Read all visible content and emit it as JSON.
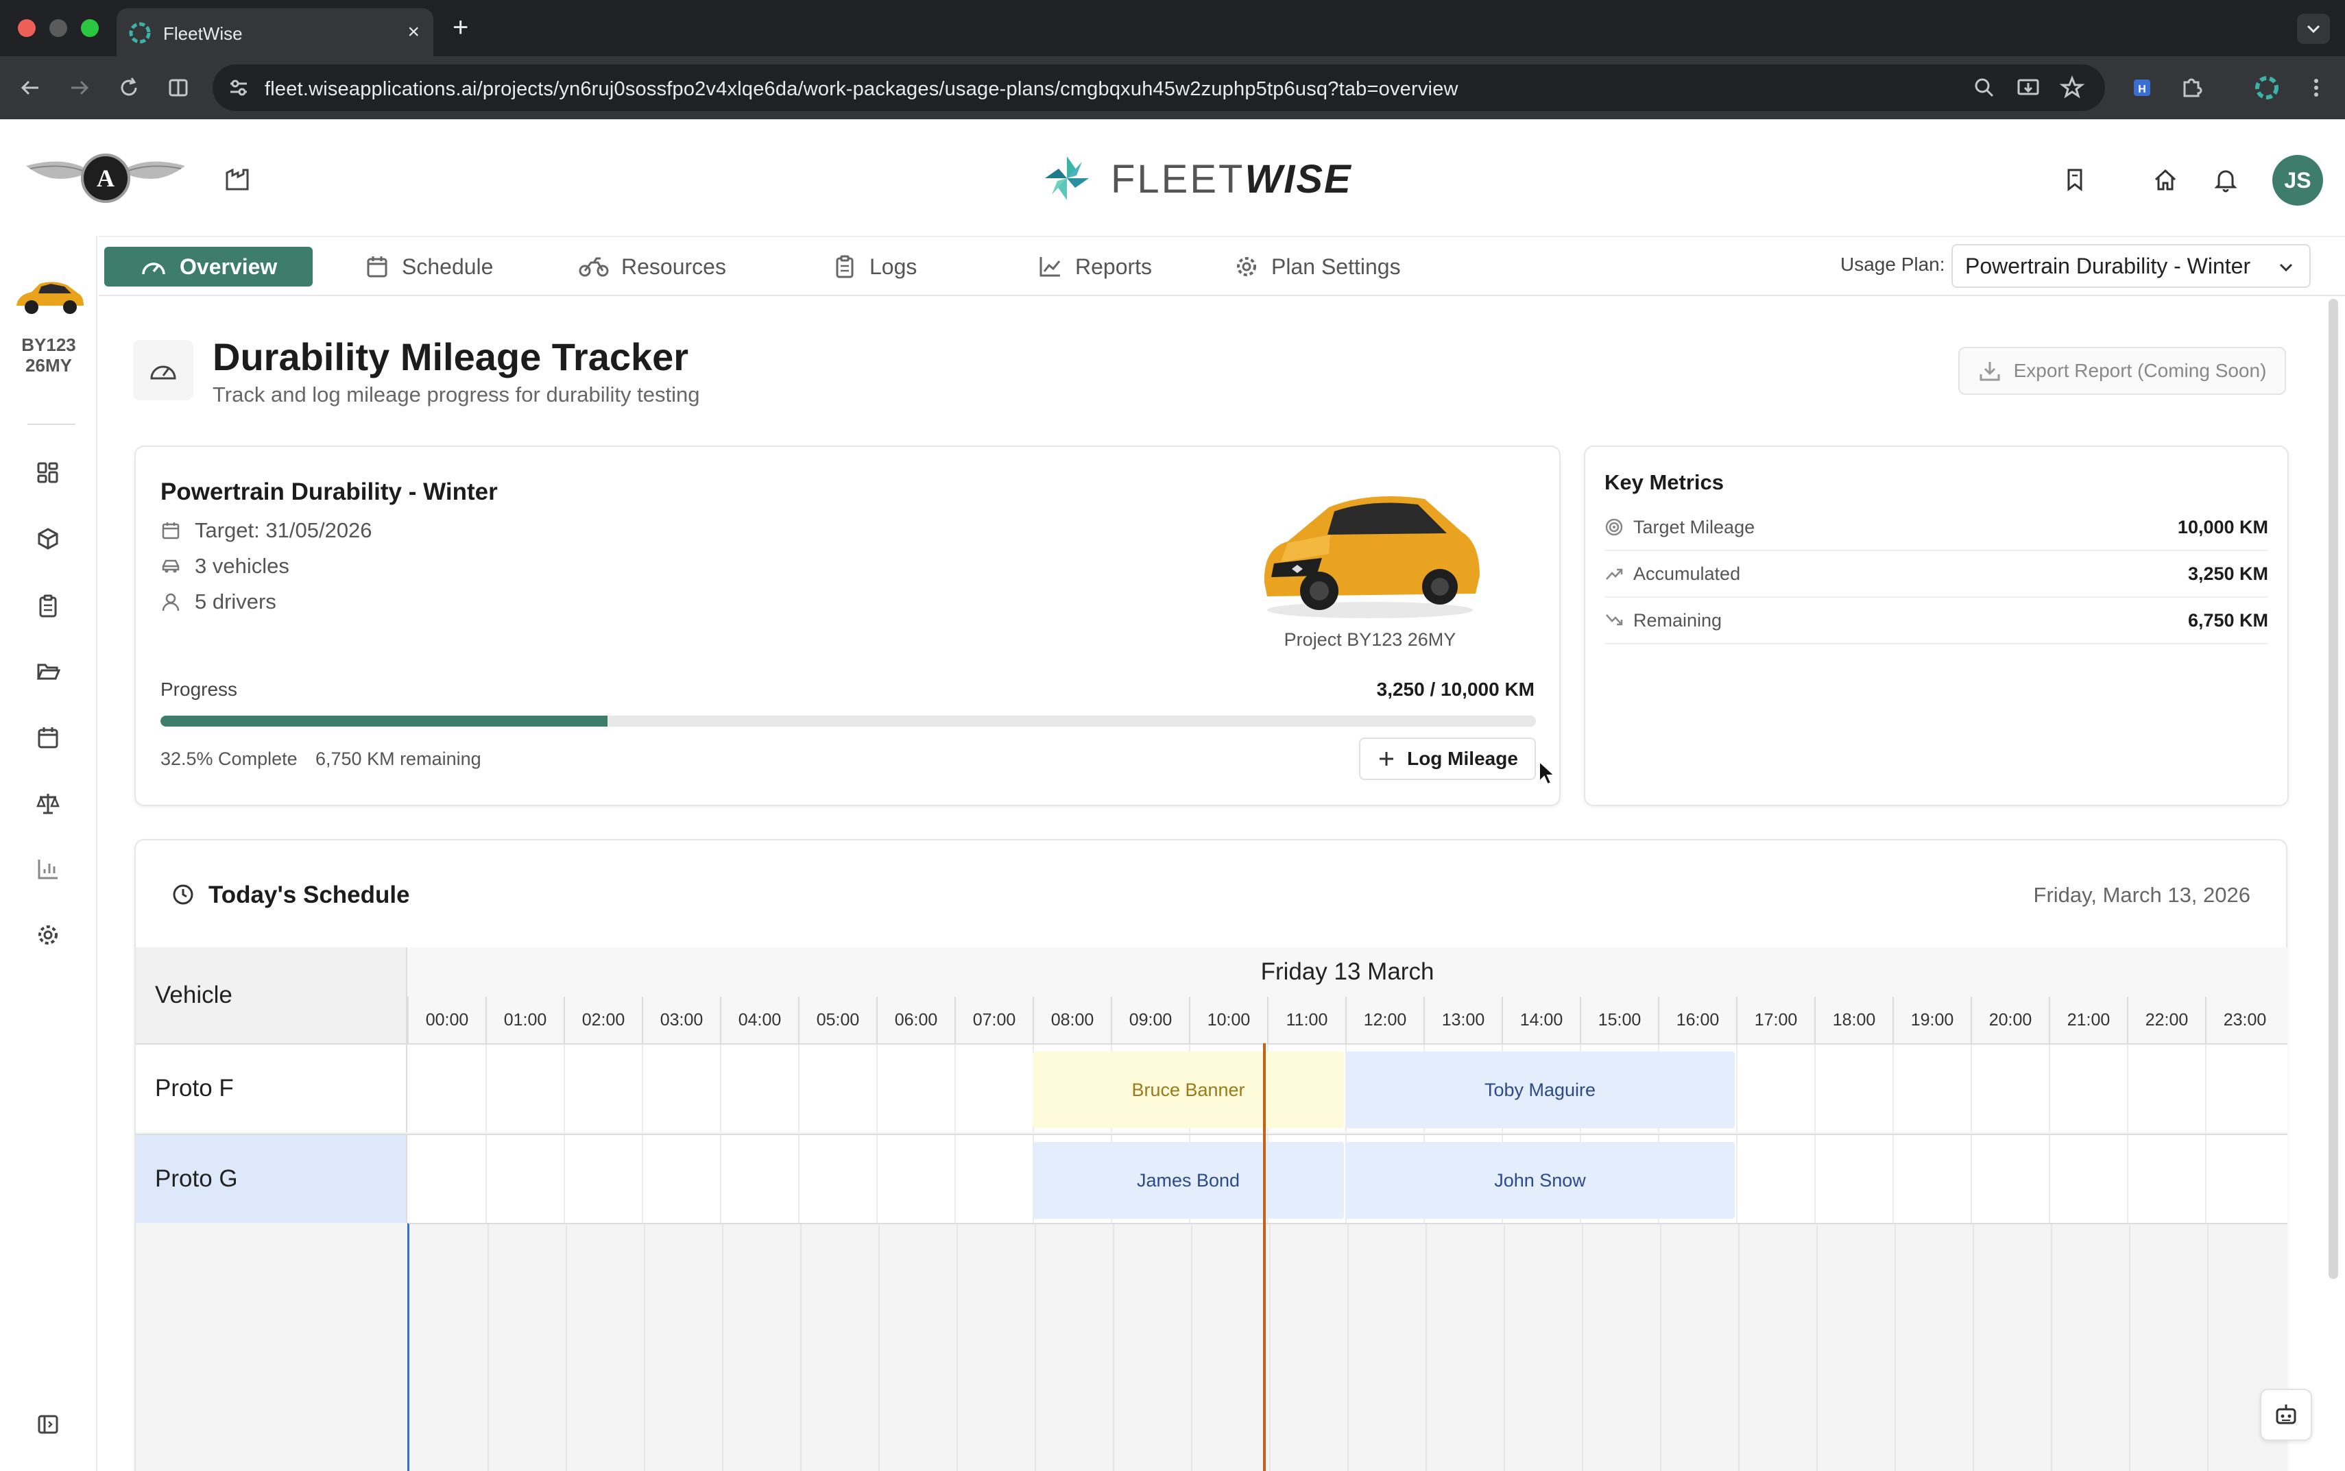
{
  "browser": {
    "tab_title": "FleetWise",
    "url": "fleet.wiseapplications.ai/projects/yn6ruj0sossfpo2v4xlqe6da/work-packages/usage-plans/cmgbqxuh45w2zuphp5tp6usq?tab=overview"
  },
  "brand": {
    "name_light": "FLEET",
    "name_bold": "WISE"
  },
  "user": {
    "initials": "JS"
  },
  "sidebar": {
    "vehicle_code_line1": "BY123",
    "vehicle_code_line2": "26MY",
    "icons": [
      "dashboard-icon",
      "cube-icon",
      "clipboard-icon",
      "folder-icon",
      "calendar-icon",
      "scales-icon",
      "bar-chart-icon",
      "gear-icon"
    ]
  },
  "nav": {
    "tabs": [
      {
        "label": "Overview",
        "icon": "gauge-icon",
        "active": true
      },
      {
        "label": "Schedule",
        "icon": "calendar-icon",
        "active": false
      },
      {
        "label": "Resources",
        "icon": "motorbike-icon",
        "active": false
      },
      {
        "label": "Logs",
        "icon": "clipboard-icon",
        "active": false
      },
      {
        "label": "Reports",
        "icon": "trend-chart-icon",
        "active": false
      },
      {
        "label": "Plan Settings",
        "icon": "gear-icon",
        "active": false
      }
    ],
    "usage_plan_label": "Usage Plan:",
    "usage_plan_value": "Powertrain Durability - Winter"
  },
  "page": {
    "title": "Durability Mileage Tracker",
    "subtitle": "Track and log mileage progress for durability testing",
    "export_label": "Export Report (Coming Soon)"
  },
  "plan": {
    "name": "Powertrain Durability - Winter",
    "target": "Target: 31/05/2026",
    "vehicles": "3 vehicles",
    "drivers": "5 drivers",
    "car_caption": "Project BY123 26MY",
    "progress_label": "Progress",
    "progress_value": "3,250 / 10,000 KM",
    "progress_fraction": 0.325,
    "complete_text": "32.5% Complete",
    "remaining_text": "6,750 KM remaining",
    "log_button": "Log Mileage"
  },
  "metrics": {
    "title": "Key Metrics",
    "rows": [
      {
        "label": "Target Mileage",
        "value": "10,000 KM",
        "icon": "target-icon"
      },
      {
        "label": "Accumulated",
        "value": "3,250 KM",
        "icon": "trend-up-icon"
      },
      {
        "label": "Remaining",
        "value": "6,750 KM",
        "icon": "trend-down-icon"
      }
    ]
  },
  "schedule": {
    "title": "Today's Schedule",
    "date": "Friday, March 13, 2026",
    "vehicle_header": "Vehicle",
    "day_label": "Friday 13 March",
    "hours": [
      "00:00",
      "01:00",
      "02:00",
      "03:00",
      "04:00",
      "05:00",
      "06:00",
      "07:00",
      "08:00",
      "09:00",
      "10:00",
      "11:00",
      "12:00",
      "13:00",
      "14:00",
      "15:00",
      "16:00",
      "17:00",
      "18:00",
      "19:00",
      "20:00",
      "21:00",
      "22:00",
      "23:00"
    ],
    "rows": [
      {
        "vehicle": "Proto F",
        "bookings": [
          {
            "driver": "Bruce Banner",
            "start": 8,
            "end": 12,
            "style": "yellow"
          },
          {
            "driver": "Toby Maguire",
            "start": 12,
            "end": 17,
            "style": "blue"
          }
        ]
      },
      {
        "vehicle": "Proto G",
        "bookings": [
          {
            "driver": "James Bond",
            "start": 8,
            "end": 12,
            "style": "blue"
          },
          {
            "driver": "John Snow",
            "start": 12,
            "end": 17,
            "style": "blue"
          }
        ]
      }
    ],
    "now_hour": 10.95
  },
  "colors": {
    "accent": "#3d7d6a",
    "booking_yellow": "#fdfbd9",
    "booking_yellow_text": "#9a7a1a",
    "booking_blue": "#e3edfc",
    "booking_blue_text": "#2a4a8a",
    "now_line": "#c8601a",
    "selected_row": "#dde8fb"
  }
}
